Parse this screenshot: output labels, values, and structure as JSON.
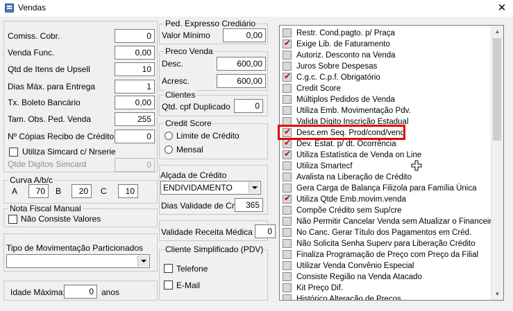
{
  "window": {
    "title": "Vendas"
  },
  "left": {
    "fields": [
      {
        "label": "Comiss. Cobr.",
        "value": "0"
      },
      {
        "label": "Venda Func.",
        "value": "0,00"
      },
      {
        "label": "Qtd de Itens de Upsell",
        "value": "10"
      },
      {
        "label": "Dias Máx. para Entrega",
        "value": "1"
      },
      {
        "label": "Tx. Boleto Bancário",
        "value": "0,00"
      },
      {
        "label": "Tam. Obs. Ped. Venda",
        "value": "255"
      },
      {
        "label": "Nº Cópias Recibo de Crédito",
        "value": "0"
      }
    ],
    "simcard_checkbox": "Utiliza Simcard c/ Nrserie",
    "qtde_digitos_label": "Qtde Digitos Simcard",
    "qtde_digitos_value": "0",
    "curva": {
      "title": "Curva A/b/c",
      "a_label": "A",
      "a": "70",
      "b_label": "B",
      "b": "20",
      "c_label": "C",
      "c": "10"
    },
    "nota": {
      "title": "Nota Fiscal Manual",
      "checkbox": "Não Consiste Valores"
    },
    "tipo_mov": {
      "label": "Tipo de Movimentação Particionados",
      "value": ""
    },
    "idade": {
      "label": "Idade Máxima:",
      "value": "0",
      "unit": "anos"
    }
  },
  "middle": {
    "ped_expresso": {
      "title": "Ped. Expresso Crediário",
      "label": "Valor Mínimo",
      "value": "0,00"
    },
    "preco_venda": {
      "title": "Preco Venda",
      "desc_label": "Desc.",
      "desc": "600,00",
      "acresc_label": "Acresc.",
      "acresc": "600,00"
    },
    "clientes": {
      "title": "Clientes",
      "label": "Qtd. cpf Duplicado",
      "value": "0"
    },
    "credit_score": {
      "title": "Credit Score",
      "opt1": "Limite de Crédito",
      "opt2": "Mensal"
    },
    "alcada": {
      "title": "Alçada de Crédito",
      "combo": "ENDIVIDAMENTO",
      "dias_label": "Dias Validade de Crédito",
      "dias": "365"
    },
    "validade": {
      "label": "Validade Receita Médica",
      "value": "0"
    },
    "cliente_simpl": {
      "title": "Cliente Simplificado (PDV)",
      "telefone": "Telefone",
      "email": "E-Mail"
    }
  },
  "options": [
    {
      "label": "Restr. Cond.pagto. p/ Praça",
      "checked": false
    },
    {
      "label": "Exige Lib. de Faturamento",
      "checked": true
    },
    {
      "label": "Autoriz. Desconto na Venda",
      "checked": false
    },
    {
      "label": "Juros Sobre Despesas",
      "checked": false
    },
    {
      "label": "C.g.c. C.p.f. Obrigatório",
      "checked": true
    },
    {
      "label": "Credit Score",
      "checked": false
    },
    {
      "label": "Múltiplos Pedidos de Venda",
      "checked": false
    },
    {
      "label": "Utiliza Emb. Movimentação Pdv.",
      "checked": false
    },
    {
      "label": "Valida Dígito Inscrição Estadual",
      "checked": false
    },
    {
      "label": "Desc.em Seq. Prod/cond/vend",
      "checked": true
    },
    {
      "label": "Dev. Estat. p/ dt. Ocorrência",
      "checked": true
    },
    {
      "label": "Utiliza Estatística de Venda on Line",
      "checked": true
    },
    {
      "label": "Utiliza Smartecf",
      "checked": false
    },
    {
      "label": "Avalista na Liberação de Crédito",
      "checked": false
    },
    {
      "label": "Gera Carga de Balança Filizola para Família Única",
      "checked": false
    },
    {
      "label": "Utiliza Qtde Emb.movim.venda",
      "checked": true
    },
    {
      "label": "Compõe Crédito sem  Sup/cre",
      "checked": false
    },
    {
      "label": "Não Permitir Cancelar Venda sem Atualizar o Financeiro",
      "checked": false
    },
    {
      "label": "No Canc. Gerar Título dos Pagamentos em Créd.",
      "checked": false
    },
    {
      "label": "Não Solicita Senha Superv para Liberação Crédito",
      "checked": false
    },
    {
      "label": "Finaliza Programação de Preço com Preço da Filial",
      "checked": false
    },
    {
      "label": "Utilizar Venda Convênio Especial",
      "checked": false
    },
    {
      "label": "Consiste Região na Venda Atacado",
      "checked": false
    },
    {
      "label": "Kit Preço Dif.",
      "checked": false
    },
    {
      "label": "Histórico Alteração de Precos",
      "checked": false
    }
  ]
}
